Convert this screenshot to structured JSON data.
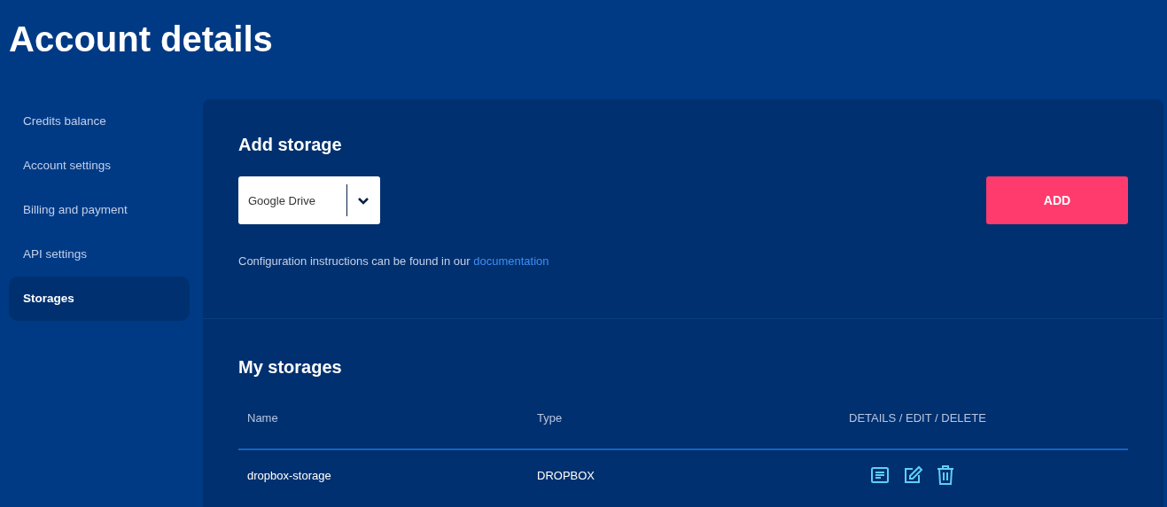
{
  "page": {
    "title": "Account details"
  },
  "sidebar": {
    "items": [
      {
        "label": "Credits balance",
        "selected": false
      },
      {
        "label": "Account settings",
        "selected": false
      },
      {
        "label": "Billing and payment",
        "selected": false
      },
      {
        "label": "API settings",
        "selected": false
      },
      {
        "label": "Storages",
        "selected": true
      }
    ]
  },
  "add_storage": {
    "heading": "Add storage",
    "select": {
      "value": "Google Drive"
    },
    "button": "ADD",
    "hint": "Configuration instructions can be found in our",
    "link": "documentation"
  },
  "my_storages": {
    "heading": "My storages",
    "table": {
      "columns": [
        "Name",
        "Type",
        "DETAILS / EDIT / DELETE"
      ],
      "rows": [
        {
          "name": "dropbox-storage",
          "type": "DROPBOX"
        }
      ]
    }
  }
}
